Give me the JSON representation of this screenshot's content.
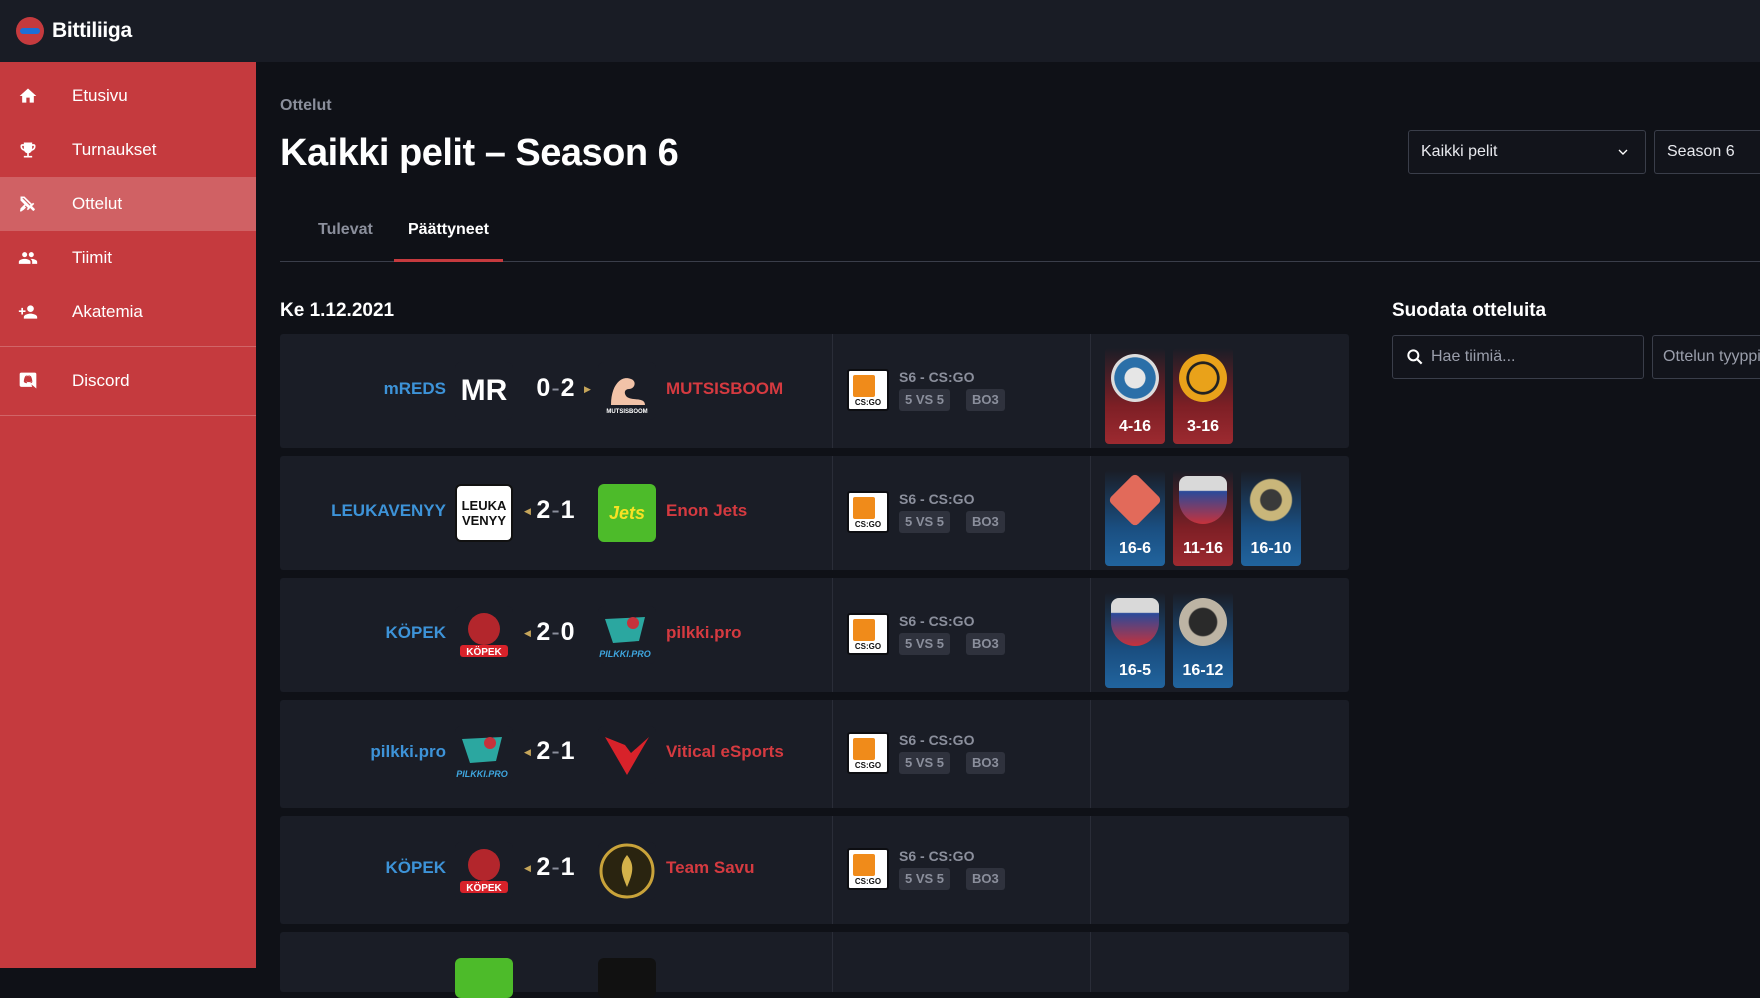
{
  "app": {
    "name": "Bittiliiga"
  },
  "sidebar": {
    "items": [
      {
        "label": "Etusivu",
        "icon": "home-icon"
      },
      {
        "label": "Turnaukset",
        "icon": "trophy-icon"
      },
      {
        "label": "Ottelut",
        "icon": "swords-icon",
        "active": true
      },
      {
        "label": "Tiimit",
        "icon": "group-icon"
      },
      {
        "label": "Akatemia",
        "icon": "person-add-icon"
      },
      {
        "label": "Discord",
        "icon": "discord-icon"
      }
    ]
  },
  "page": {
    "breadcrumb": "Ottelut",
    "title": "Kaikki pelit – Season 6",
    "game_select": "Kaikki pelit",
    "season_select": "Season 6"
  },
  "tabs": [
    {
      "label": "Tulevat",
      "active": false
    },
    {
      "label": "Päättyneet",
      "active": true
    }
  ],
  "date_label": "Ke 1.12.2021",
  "filter": {
    "title": "Suodata otteluita",
    "search_placeholder": "Hae tiimiä...",
    "type_placeholder": "Ottelun tyyppi"
  },
  "matches": [
    {
      "home": "mREDS",
      "away": "MUTSISBOOM",
      "score_home": "0",
      "score_away": "2",
      "winner": "away",
      "game": "S6 - CS:GO",
      "format": "5 VS 5",
      "series": "BO3",
      "maps": [
        {
          "score": "4-16",
          "result": "loss",
          "map": "nuke-icon"
        },
        {
          "score": "3-16",
          "result": "loss",
          "map": "overpass-icon"
        }
      ]
    },
    {
      "home": "LEUKAVENYY",
      "away": "Enon Jets",
      "score_home": "2",
      "score_away": "1",
      "winner": "home",
      "game": "S6 - CS:GO",
      "format": "5 VS 5",
      "series": "BO3",
      "maps": [
        {
          "score": "16-6",
          "result": "win",
          "map": "mirage-icon"
        },
        {
          "score": "11-16",
          "result": "loss",
          "map": "inferno-icon"
        },
        {
          "score": "16-10",
          "result": "win",
          "map": "ancient-icon"
        }
      ]
    },
    {
      "home": "KÖPEK",
      "away": "pilkki.pro",
      "score_home": "2",
      "score_away": "0",
      "winner": "home",
      "game": "S6 - CS:GO",
      "format": "5 VS 5",
      "series": "BO3",
      "maps": [
        {
          "score": "16-5",
          "result": "win",
          "map": "inferno-icon"
        },
        {
          "score": "16-12",
          "result": "win",
          "map": "dust2-icon"
        }
      ]
    },
    {
      "home": "pilkki.pro",
      "away": "Vitical eSports",
      "score_home": "2",
      "score_away": "1",
      "winner": "home",
      "game": "S6 - CS:GO",
      "format": "5 VS 5",
      "series": "BO3",
      "maps": []
    },
    {
      "home": "KÖPEK",
      "away": "Team Savu",
      "score_home": "2",
      "score_away": "1",
      "winner": "home",
      "game": "S6 - CS:GO",
      "format": "5 VS 5",
      "series": "BO3",
      "maps": []
    }
  ]
}
